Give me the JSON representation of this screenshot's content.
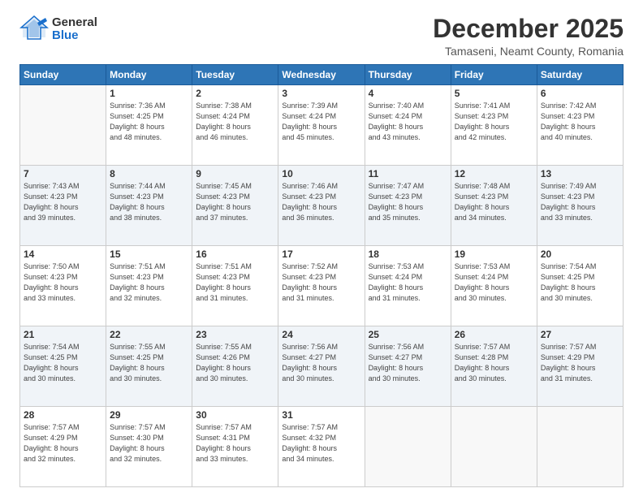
{
  "logo": {
    "general": "General",
    "blue": "Blue"
  },
  "title": "December 2025",
  "location": "Tamaseni, Neamt County, Romania",
  "days_of_week": [
    "Sunday",
    "Monday",
    "Tuesday",
    "Wednesday",
    "Thursday",
    "Friday",
    "Saturday"
  ],
  "weeks": [
    [
      {
        "num": "",
        "info": ""
      },
      {
        "num": "1",
        "info": "Sunrise: 7:36 AM\nSunset: 4:25 PM\nDaylight: 8 hours\nand 48 minutes."
      },
      {
        "num": "2",
        "info": "Sunrise: 7:38 AM\nSunset: 4:24 PM\nDaylight: 8 hours\nand 46 minutes."
      },
      {
        "num": "3",
        "info": "Sunrise: 7:39 AM\nSunset: 4:24 PM\nDaylight: 8 hours\nand 45 minutes."
      },
      {
        "num": "4",
        "info": "Sunrise: 7:40 AM\nSunset: 4:24 PM\nDaylight: 8 hours\nand 43 minutes."
      },
      {
        "num": "5",
        "info": "Sunrise: 7:41 AM\nSunset: 4:23 PM\nDaylight: 8 hours\nand 42 minutes."
      },
      {
        "num": "6",
        "info": "Sunrise: 7:42 AM\nSunset: 4:23 PM\nDaylight: 8 hours\nand 40 minutes."
      }
    ],
    [
      {
        "num": "7",
        "info": "Sunrise: 7:43 AM\nSunset: 4:23 PM\nDaylight: 8 hours\nand 39 minutes."
      },
      {
        "num": "8",
        "info": "Sunrise: 7:44 AM\nSunset: 4:23 PM\nDaylight: 8 hours\nand 38 minutes."
      },
      {
        "num": "9",
        "info": "Sunrise: 7:45 AM\nSunset: 4:23 PM\nDaylight: 8 hours\nand 37 minutes."
      },
      {
        "num": "10",
        "info": "Sunrise: 7:46 AM\nSunset: 4:23 PM\nDaylight: 8 hours\nand 36 minutes."
      },
      {
        "num": "11",
        "info": "Sunrise: 7:47 AM\nSunset: 4:23 PM\nDaylight: 8 hours\nand 35 minutes."
      },
      {
        "num": "12",
        "info": "Sunrise: 7:48 AM\nSunset: 4:23 PM\nDaylight: 8 hours\nand 34 minutes."
      },
      {
        "num": "13",
        "info": "Sunrise: 7:49 AM\nSunset: 4:23 PM\nDaylight: 8 hours\nand 33 minutes."
      }
    ],
    [
      {
        "num": "14",
        "info": "Sunrise: 7:50 AM\nSunset: 4:23 PM\nDaylight: 8 hours\nand 33 minutes."
      },
      {
        "num": "15",
        "info": "Sunrise: 7:51 AM\nSunset: 4:23 PM\nDaylight: 8 hours\nand 32 minutes."
      },
      {
        "num": "16",
        "info": "Sunrise: 7:51 AM\nSunset: 4:23 PM\nDaylight: 8 hours\nand 31 minutes."
      },
      {
        "num": "17",
        "info": "Sunrise: 7:52 AM\nSunset: 4:23 PM\nDaylight: 8 hours\nand 31 minutes."
      },
      {
        "num": "18",
        "info": "Sunrise: 7:53 AM\nSunset: 4:24 PM\nDaylight: 8 hours\nand 31 minutes."
      },
      {
        "num": "19",
        "info": "Sunrise: 7:53 AM\nSunset: 4:24 PM\nDaylight: 8 hours\nand 30 minutes."
      },
      {
        "num": "20",
        "info": "Sunrise: 7:54 AM\nSunset: 4:25 PM\nDaylight: 8 hours\nand 30 minutes."
      }
    ],
    [
      {
        "num": "21",
        "info": "Sunrise: 7:54 AM\nSunset: 4:25 PM\nDaylight: 8 hours\nand 30 minutes."
      },
      {
        "num": "22",
        "info": "Sunrise: 7:55 AM\nSunset: 4:25 PM\nDaylight: 8 hours\nand 30 minutes."
      },
      {
        "num": "23",
        "info": "Sunrise: 7:55 AM\nSunset: 4:26 PM\nDaylight: 8 hours\nand 30 minutes."
      },
      {
        "num": "24",
        "info": "Sunrise: 7:56 AM\nSunset: 4:27 PM\nDaylight: 8 hours\nand 30 minutes."
      },
      {
        "num": "25",
        "info": "Sunrise: 7:56 AM\nSunset: 4:27 PM\nDaylight: 8 hours\nand 30 minutes."
      },
      {
        "num": "26",
        "info": "Sunrise: 7:57 AM\nSunset: 4:28 PM\nDaylight: 8 hours\nand 30 minutes."
      },
      {
        "num": "27",
        "info": "Sunrise: 7:57 AM\nSunset: 4:29 PM\nDaylight: 8 hours\nand 31 minutes."
      }
    ],
    [
      {
        "num": "28",
        "info": "Sunrise: 7:57 AM\nSunset: 4:29 PM\nDaylight: 8 hours\nand 32 minutes."
      },
      {
        "num": "29",
        "info": "Sunrise: 7:57 AM\nSunset: 4:30 PM\nDaylight: 8 hours\nand 32 minutes."
      },
      {
        "num": "30",
        "info": "Sunrise: 7:57 AM\nSunset: 4:31 PM\nDaylight: 8 hours\nand 33 minutes."
      },
      {
        "num": "31",
        "info": "Sunrise: 7:57 AM\nSunset: 4:32 PM\nDaylight: 8 hours\nand 34 minutes."
      },
      {
        "num": "",
        "info": ""
      },
      {
        "num": "",
        "info": ""
      },
      {
        "num": "",
        "info": ""
      }
    ]
  ]
}
